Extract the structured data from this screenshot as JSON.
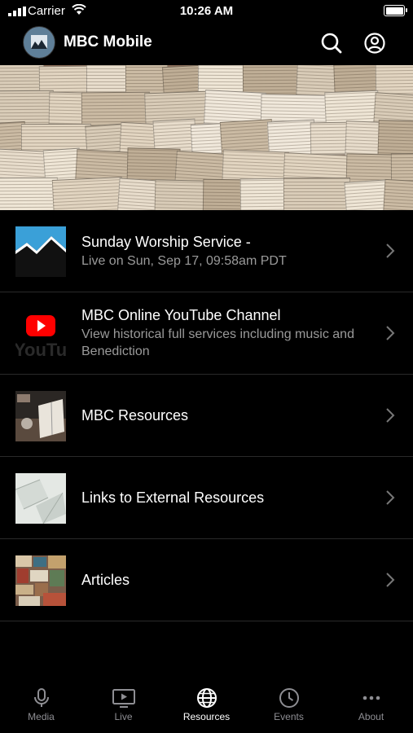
{
  "status": {
    "carrier": "Carrier",
    "time": "10:26 AM",
    "battery_level": 1.0
  },
  "header": {
    "title": "MBC Mobile",
    "icons": [
      "search-icon",
      "account-icon"
    ]
  },
  "items": [
    {
      "title": "Sunday Worship Service -",
      "subtitle": "Live on Sun, Sep 17, 09:58am PDT",
      "thumb": "mountain-thumb"
    },
    {
      "title": "MBC Online YouTube Channel",
      "subtitle": "View historical full services including music and Benediction",
      "thumb": "youtube-thumb"
    },
    {
      "title": "MBC Resources",
      "subtitle": "",
      "thumb": "book-thumb"
    },
    {
      "title": "Links to External Resources",
      "subtitle": "",
      "thumb": "paper-thumb"
    },
    {
      "title": "Articles",
      "subtitle": "",
      "thumb": "articles-thumb"
    }
  ],
  "tabs": [
    {
      "label": "Media",
      "icon": "microphone-icon"
    },
    {
      "label": "Live",
      "icon": "tv-play-icon"
    },
    {
      "label": "Resources",
      "icon": "globe-icon",
      "active": true
    },
    {
      "label": "Events",
      "icon": "clock-icon"
    },
    {
      "label": "About",
      "icon": "more-icon"
    }
  ],
  "colors": {
    "background": "#000000",
    "subtitle": "#9a9a9a",
    "inactive_tab": "#8e8e93",
    "youtube_red": "#ff0000"
  }
}
